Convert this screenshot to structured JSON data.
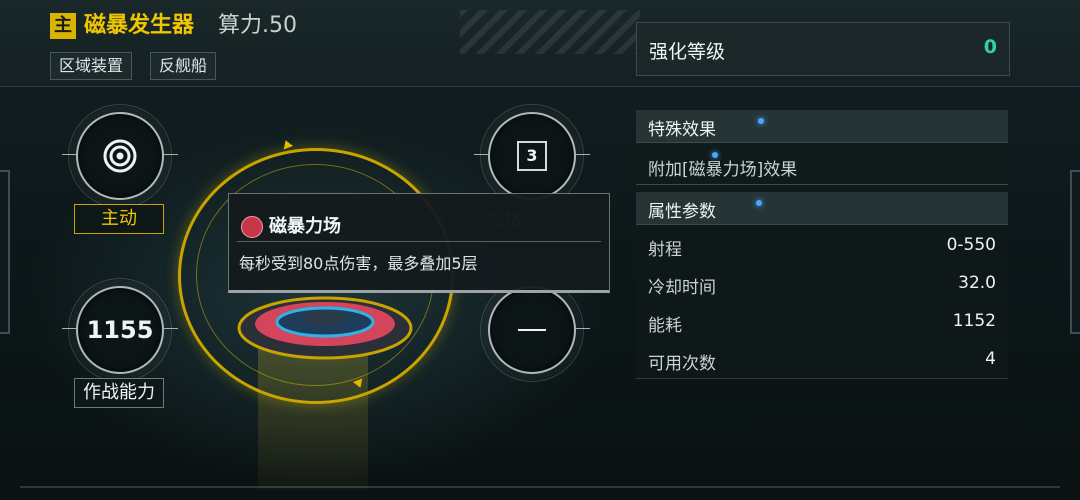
{
  "header": {
    "main_tag": "主",
    "title": "磁暴发生器",
    "power_text": "算力.50",
    "tags": [
      "区域装置",
      "反舰船"
    ]
  },
  "left_stats": {
    "mode_icon": "target-ring-icon",
    "mode_label": "主动",
    "combat_value": "1155",
    "combat_label": "作战能力"
  },
  "right_stats": {
    "slot_count": "3",
    "spec_label": "规格",
    "dash_value": "—"
  },
  "tooltip": {
    "icon": "magnetic-storm-icon",
    "title": "磁暴力场",
    "description": "每秒受到80点伤害，最多叠加5层"
  },
  "enhance": {
    "label": "强化等级",
    "value": "0"
  },
  "special": {
    "header": "特殊效果",
    "text": "附加[磁暴力场]效果"
  },
  "attributes": {
    "header": "属性参数",
    "rows": [
      {
        "key": "射程",
        "value": "0-550"
      },
      {
        "key": "冷却时间",
        "value": "32.0"
      },
      {
        "key": "能耗",
        "value": "1152"
      },
      {
        "key": "可用次数",
        "value": "4"
      }
    ]
  },
  "colors": {
    "accent_yellow": "#f0c600",
    "enhance_green": "#2fd3a3"
  }
}
